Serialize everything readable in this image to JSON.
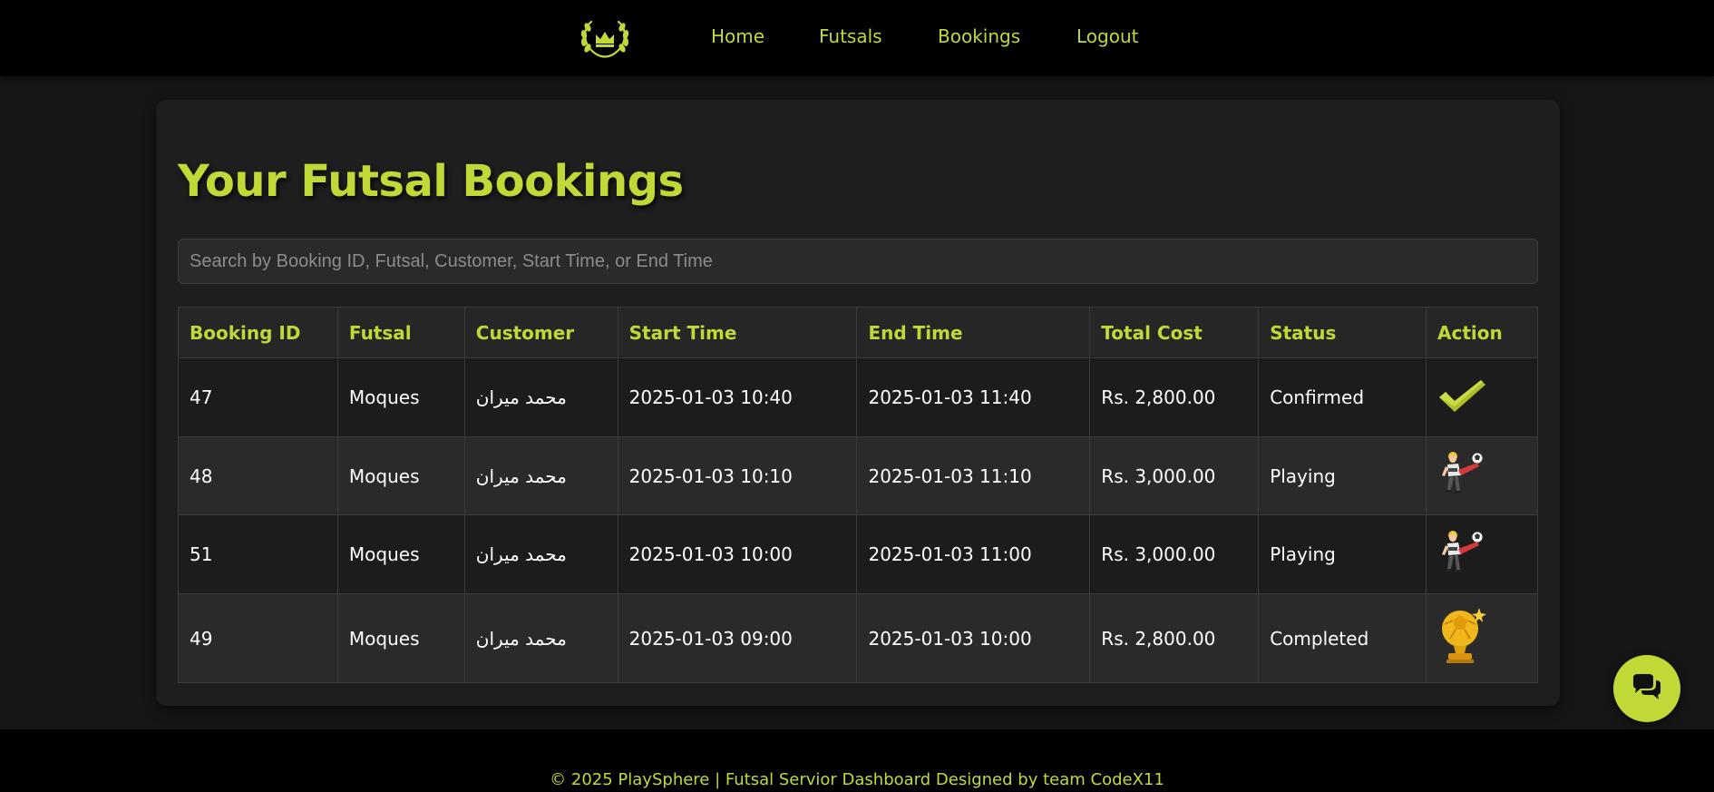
{
  "nav": {
    "logo_icon": "laurel-crown-logo-icon",
    "items": [
      {
        "label": "Home"
      },
      {
        "label": "Futsals"
      },
      {
        "label": "Bookings"
      },
      {
        "label": "Logout"
      }
    ]
  },
  "main": {
    "title": "Your Futsal Bookings",
    "search": {
      "placeholder": "Search by Booking ID, Futsal, Customer, Start Time, or End Time",
      "value": ""
    },
    "table": {
      "headers": [
        "Booking ID",
        "Futsal",
        "Customer",
        "Start Time",
        "End Time",
        "Total Cost",
        "Status",
        "Action"
      ],
      "rows": [
        {
          "booking_id": "47",
          "futsal": "Moques",
          "customer": "محمد میران",
          "start_time": "2025-01-03 10:40",
          "end_time": "2025-01-03 11:40",
          "total_cost": "Rs. 2,800.00",
          "status": "Confirmed",
          "action_icon": "green-checkmark-icon"
        },
        {
          "booking_id": "48",
          "futsal": "Moques",
          "customer": "محمد میران",
          "start_time": "2025-01-03 10:10",
          "end_time": "2025-01-03 11:10",
          "total_cost": "Rs. 3,000.00",
          "status": "Playing",
          "action_icon": "player-kicking-ball-icon"
        },
        {
          "booking_id": "51",
          "futsal": "Moques",
          "customer": "محمد میران",
          "start_time": "2025-01-03 10:00",
          "end_time": "2025-01-03 11:00",
          "total_cost": "Rs. 3,000.00",
          "status": "Playing",
          "action_icon": "player-kicking-ball-icon"
        },
        {
          "booking_id": "49",
          "futsal": "Moques",
          "customer": "محمد میران",
          "start_time": "2025-01-03 09:00",
          "end_time": "2025-01-03 10:00",
          "total_cost": "Rs. 2,800.00",
          "status": "Completed",
          "action_icon": "golden-ball-trophy-icon"
        }
      ]
    }
  },
  "footer": {
    "text": "© 2025 PlaySphere | Futsal Servior Dashboard Designed by team CodeX11"
  },
  "chat": {
    "icon": "chat-bubbles-icon"
  },
  "colors": {
    "accent": "#c2d837",
    "navbar_bg": "#000000",
    "page_bg": "#161616",
    "card_bg": "#1e1e1e"
  }
}
